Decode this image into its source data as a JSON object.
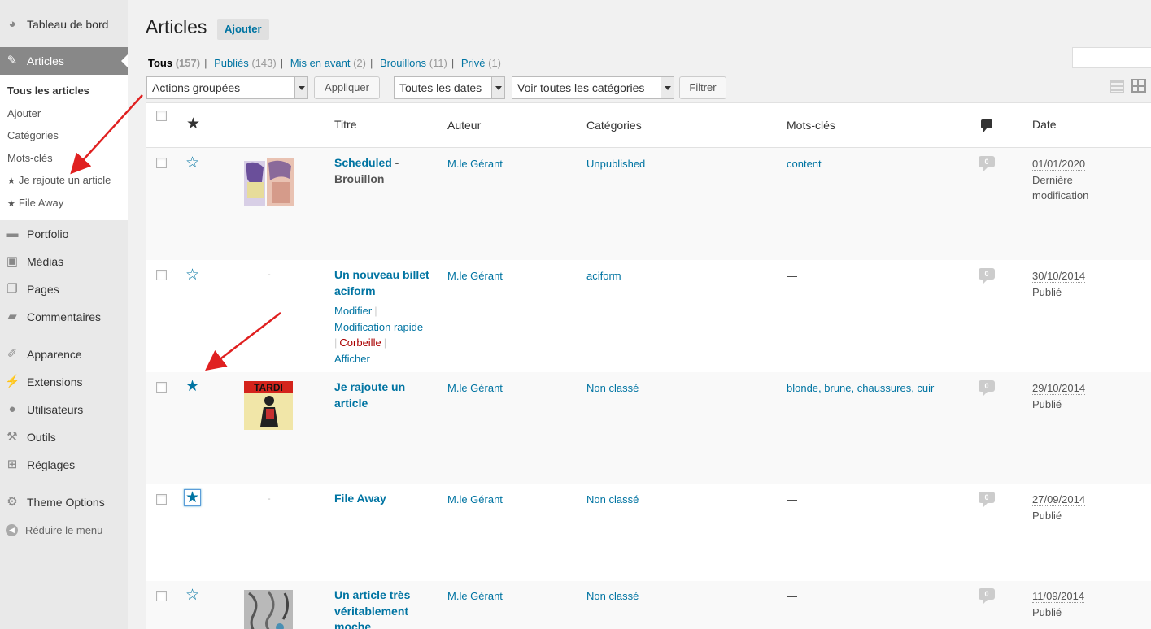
{
  "sidebar": {
    "dashboard": "Tableau de bord",
    "articles": "Articles",
    "submenu": [
      "Tous les articles",
      "Ajouter",
      "Catégories",
      "Mots-clés",
      "Je rajoute un article",
      "File Away"
    ],
    "portfolio": "Portfolio",
    "medias": "Médias",
    "pages": "Pages",
    "comments": "Commentaires",
    "appearance": "Apparence",
    "extensions": "Extensions",
    "users": "Utilisateurs",
    "tools": "Outils",
    "settings": "Réglages",
    "theme_options": "Theme Options",
    "collapse": "Réduire le menu"
  },
  "header": {
    "title": "Articles",
    "add_new": "Ajouter"
  },
  "views": [
    {
      "label": "Tous",
      "count": "(157)"
    },
    {
      "label": "Publiés",
      "count": "(143)"
    },
    {
      "label": "Mis en avant",
      "count": "(2)"
    },
    {
      "label": "Brouillons",
      "count": "(11)"
    },
    {
      "label": "Privé",
      "count": "(1)"
    }
  ],
  "filters": {
    "bulk_actions": "Actions groupées",
    "apply": "Appliquer",
    "dates": "Toutes les dates",
    "categories": "Voir toutes les catégories",
    "filter": "Filtrer"
  },
  "columns": {
    "title": "Titre",
    "author": "Auteur",
    "categories": "Catégories",
    "tags": "Mots-clés",
    "date": "Date"
  },
  "rows": [
    {
      "title": "Scheduled",
      "state": " - Brouillon",
      "author": "M.le Gérant",
      "categories": "Unpublished",
      "tags": "content",
      "comments": "0",
      "date": "01/01/2020",
      "status": "Dernière modification",
      "featured": false,
      "thumb": "comic-cover-a"
    },
    {
      "title": "Un nouveau billet aciform",
      "state": "",
      "author": "M.le Gérant",
      "categories": "aciform",
      "tags": "—",
      "comments": "0",
      "date": "30/10/2014",
      "status": "Publié",
      "featured": false,
      "thumb": "none",
      "actions": {
        "edit": "Modifier",
        "quick_edit": "Modification rapide",
        "trash": "Corbeille",
        "view": "Afficher"
      }
    },
    {
      "title": "Je rajoute un article",
      "state": "",
      "author": "M.le Gérant",
      "categories": "Non classé",
      "tags": "blonde, brune, chaussures, cuir",
      "comments": "0",
      "date": "29/10/2014",
      "status": "Publié",
      "featured": true,
      "thumb": "tardi-cover"
    },
    {
      "title": "File Away",
      "state": "",
      "author": "M.le Gérant",
      "categories": "Non classé",
      "tags": "—",
      "comments": "0",
      "date": "27/09/2014",
      "status": "Publié",
      "featured": true,
      "thumb": "none"
    },
    {
      "title": "Un article très véritablement moche",
      "state": "",
      "author": "M.le Gérant",
      "categories": "Non classé",
      "tags": "—",
      "comments": "0",
      "date": "11/09/2014",
      "status": "Publié",
      "featured": false,
      "thumb": "sketch"
    }
  ],
  "colors": {
    "link": "#0074a2",
    "sidebar_active": "#888888",
    "trash": "#aa0000",
    "annotation_arrow": "#e02020"
  }
}
